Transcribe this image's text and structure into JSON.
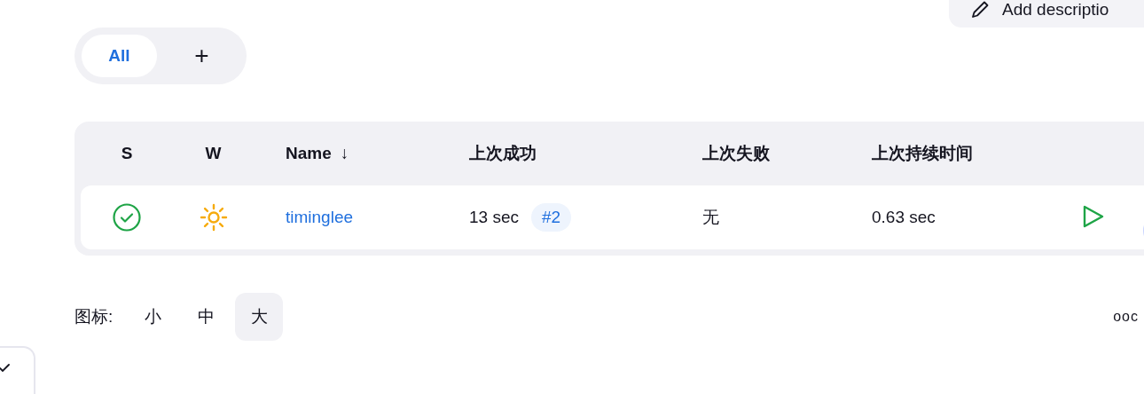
{
  "header": {
    "add_description": "Add descriptio"
  },
  "view_tabs": [
    {
      "label": "All",
      "selected": true
    },
    {
      "label": "+",
      "selected": false
    }
  ],
  "table": {
    "columns": [
      {
        "label": "S"
      },
      {
        "label": "W"
      },
      {
        "label": "Name",
        "sort_mark": "↓"
      },
      {
        "label": "上次成功"
      },
      {
        "label": "上次失败"
      },
      {
        "label": "上次持续时间"
      }
    ],
    "rows": [
      {
        "status": {
          "kind": "success"
        },
        "weather": {
          "kind": "sunny"
        },
        "name": "timinglee",
        "last_success": "13 sec",
        "last_success_build": "#2",
        "last_failure": "无",
        "last_duration": "0.63 sec"
      }
    ]
  },
  "icon_size": {
    "label": "图标:",
    "options": [
      {
        "label": "小",
        "selected": false
      },
      {
        "label": "中",
        "selected": false
      },
      {
        "label": "大",
        "selected": true
      }
    ]
  },
  "legend_link": "ooc"
}
